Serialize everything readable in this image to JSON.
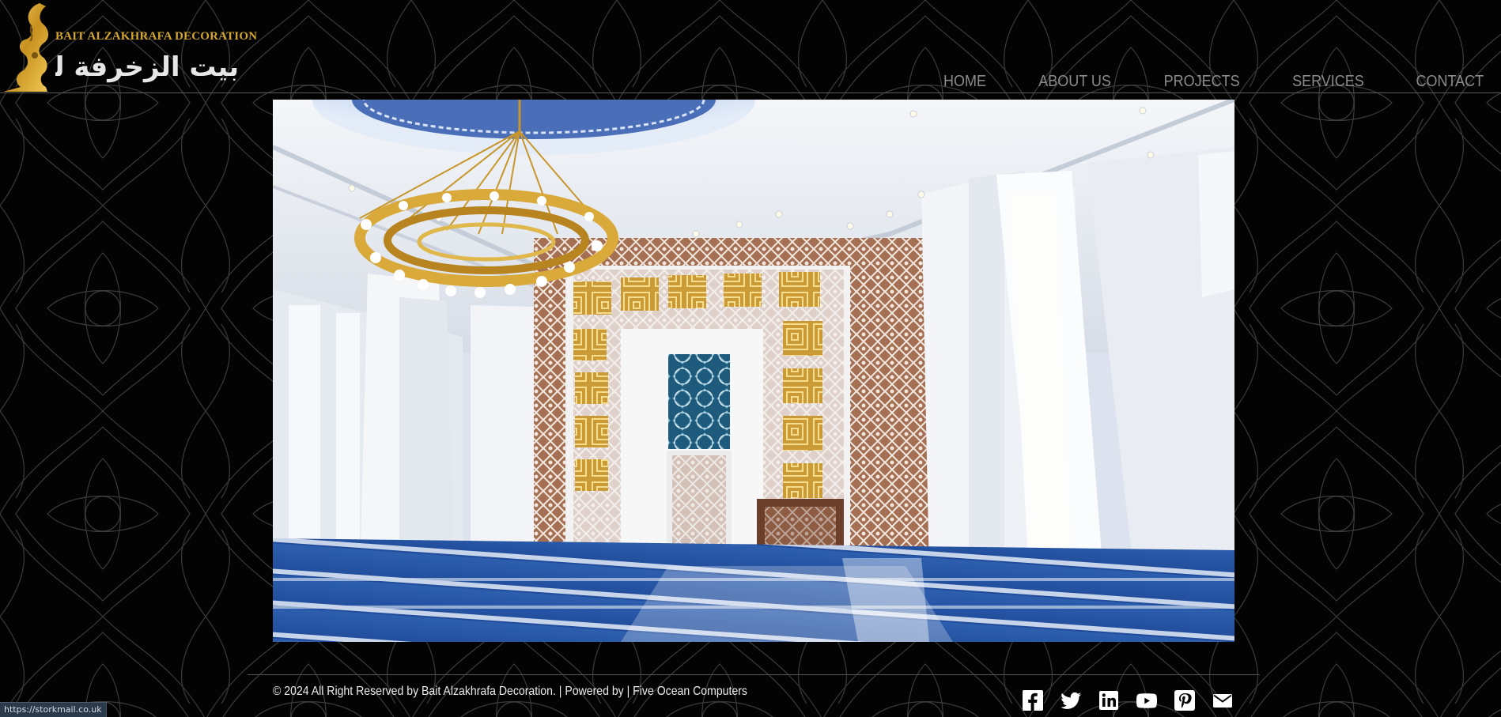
{
  "brand": {
    "name": "BAIT ALZAKHRAFA DECORATION",
    "arabic_name": "بيت الزخرفة للديكور",
    "gold_color": "#d4a72c"
  },
  "nav": {
    "items": [
      {
        "label": "HOME"
      },
      {
        "label": "ABOUT US"
      },
      {
        "label": "PROJECTS"
      },
      {
        "label": "SERVICES"
      },
      {
        "label": "CONTACT"
      }
    ],
    "color": "#8b8b8b"
  },
  "hero": {
    "image": "mosque-interior-render",
    "icon": "hero-image"
  },
  "footer": {
    "copyright": "© 2024 All Right Reserved by Bait Alzakhrafa Decoration. | Powered by | Five Ocean Computers",
    "social": [
      {
        "icon": "facebook-icon"
      },
      {
        "icon": "twitter-icon"
      },
      {
        "icon": "linkedin-icon"
      },
      {
        "icon": "youtube-icon"
      },
      {
        "icon": "pinterest-icon"
      },
      {
        "icon": "email-icon"
      }
    ]
  },
  "status_bar": {
    "url": "https://storkmail.co.uk"
  }
}
